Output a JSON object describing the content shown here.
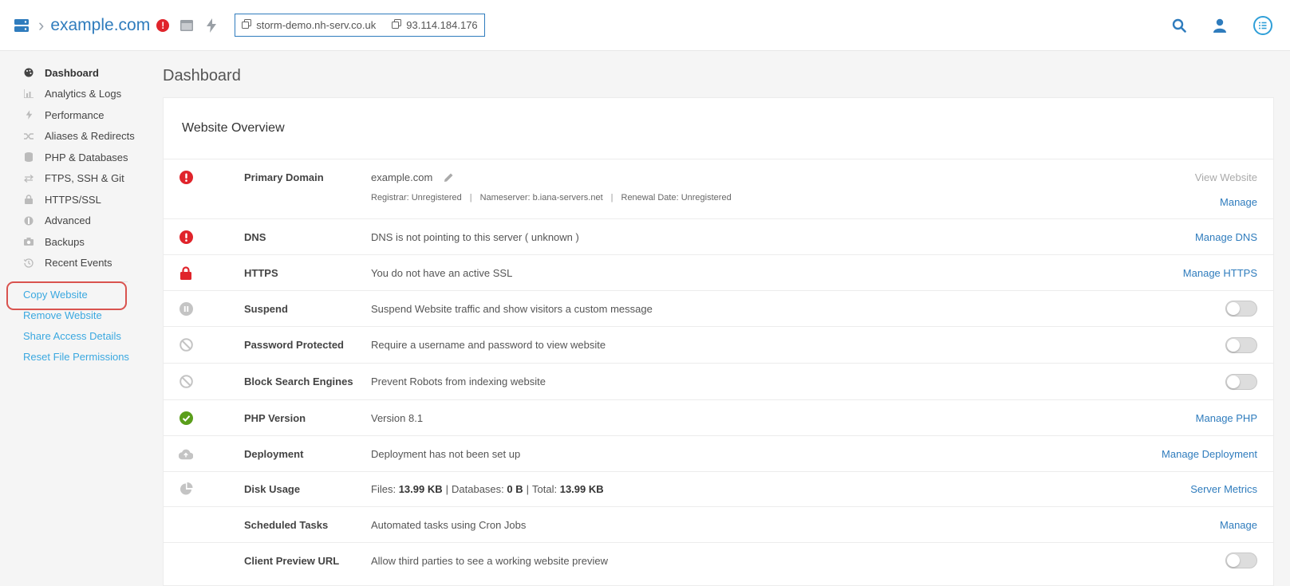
{
  "topbar": {
    "domain": "example.com",
    "alert_count": "!",
    "hostname": "storm-demo.nh-serv.co.uk",
    "ip": "93.114.184.176"
  },
  "sidebar": {
    "items": [
      {
        "label": "Dashboard",
        "icon": "palette-icon"
      },
      {
        "label": "Analytics & Logs",
        "icon": "chart-icon"
      },
      {
        "label": "Performance",
        "icon": "bolt-icon"
      },
      {
        "label": "Aliases & Redirects",
        "icon": "shuffle-icon"
      },
      {
        "label": "PHP & Databases",
        "icon": "database-icon"
      },
      {
        "label": "FTPS, SSH & Git",
        "icon": "exchange-icon"
      },
      {
        "label": "HTTPS/SSL",
        "icon": "lock-icon"
      },
      {
        "label": "Advanced",
        "icon": "wrench-icon"
      },
      {
        "label": "Backups",
        "icon": "camera-icon"
      },
      {
        "label": "Recent Events",
        "icon": "history-icon"
      }
    ],
    "actions": [
      {
        "label": "Copy Website"
      },
      {
        "label": "Remove Website"
      },
      {
        "label": "Share Access Details"
      },
      {
        "label": "Reset File Permissions"
      }
    ]
  },
  "page": {
    "title": "Dashboard",
    "card_title": "Website Overview"
  },
  "rows": {
    "primary_domain": {
      "label": "Primary Domain",
      "value": "example.com",
      "registrar": "Registrar: Unregistered",
      "nameserver": "Nameserver: b.iana-servers.net",
      "renewal": "Renewal Date: Unregistered",
      "action1": "View Website",
      "action2": "Manage"
    },
    "dns": {
      "label": "DNS",
      "desc": "DNS is not pointing to this server ( unknown )",
      "action": "Manage DNS"
    },
    "https": {
      "label": "HTTPS",
      "desc": "You do not have an active SSL",
      "action": "Manage HTTPS"
    },
    "suspend": {
      "label": "Suspend",
      "desc": "Suspend Website traffic and show visitors a custom message"
    },
    "password": {
      "label": "Password Protected",
      "desc": "Require a username and password to view website"
    },
    "block": {
      "label": "Block Search Engines",
      "desc": "Prevent Robots from indexing website"
    },
    "php": {
      "label": "PHP Version",
      "desc": "Version 8.1",
      "action": "Manage PHP"
    },
    "deploy": {
      "label": "Deployment",
      "desc": "Deployment has not been set up",
      "action": "Manage Deployment"
    },
    "disk": {
      "label": "Disk Usage",
      "files_label": "Files:",
      "files_value": "13.99 KB",
      "db_label": "Databases:",
      "db_value": "0 B",
      "total_label": "Total:",
      "total_value": "13.99 KB",
      "action": "Server Metrics"
    },
    "cron": {
      "label": "Scheduled Tasks",
      "desc": "Automated tasks using Cron Jobs",
      "action": "Manage"
    },
    "preview": {
      "label": "Client Preview URL",
      "desc": "Allow third parties to see a working website preview"
    }
  },
  "colors": {
    "accent": "#2f7cbd",
    "link": "#3aa8e0",
    "error": "#e0242b",
    "success": "#5a9e1b"
  }
}
